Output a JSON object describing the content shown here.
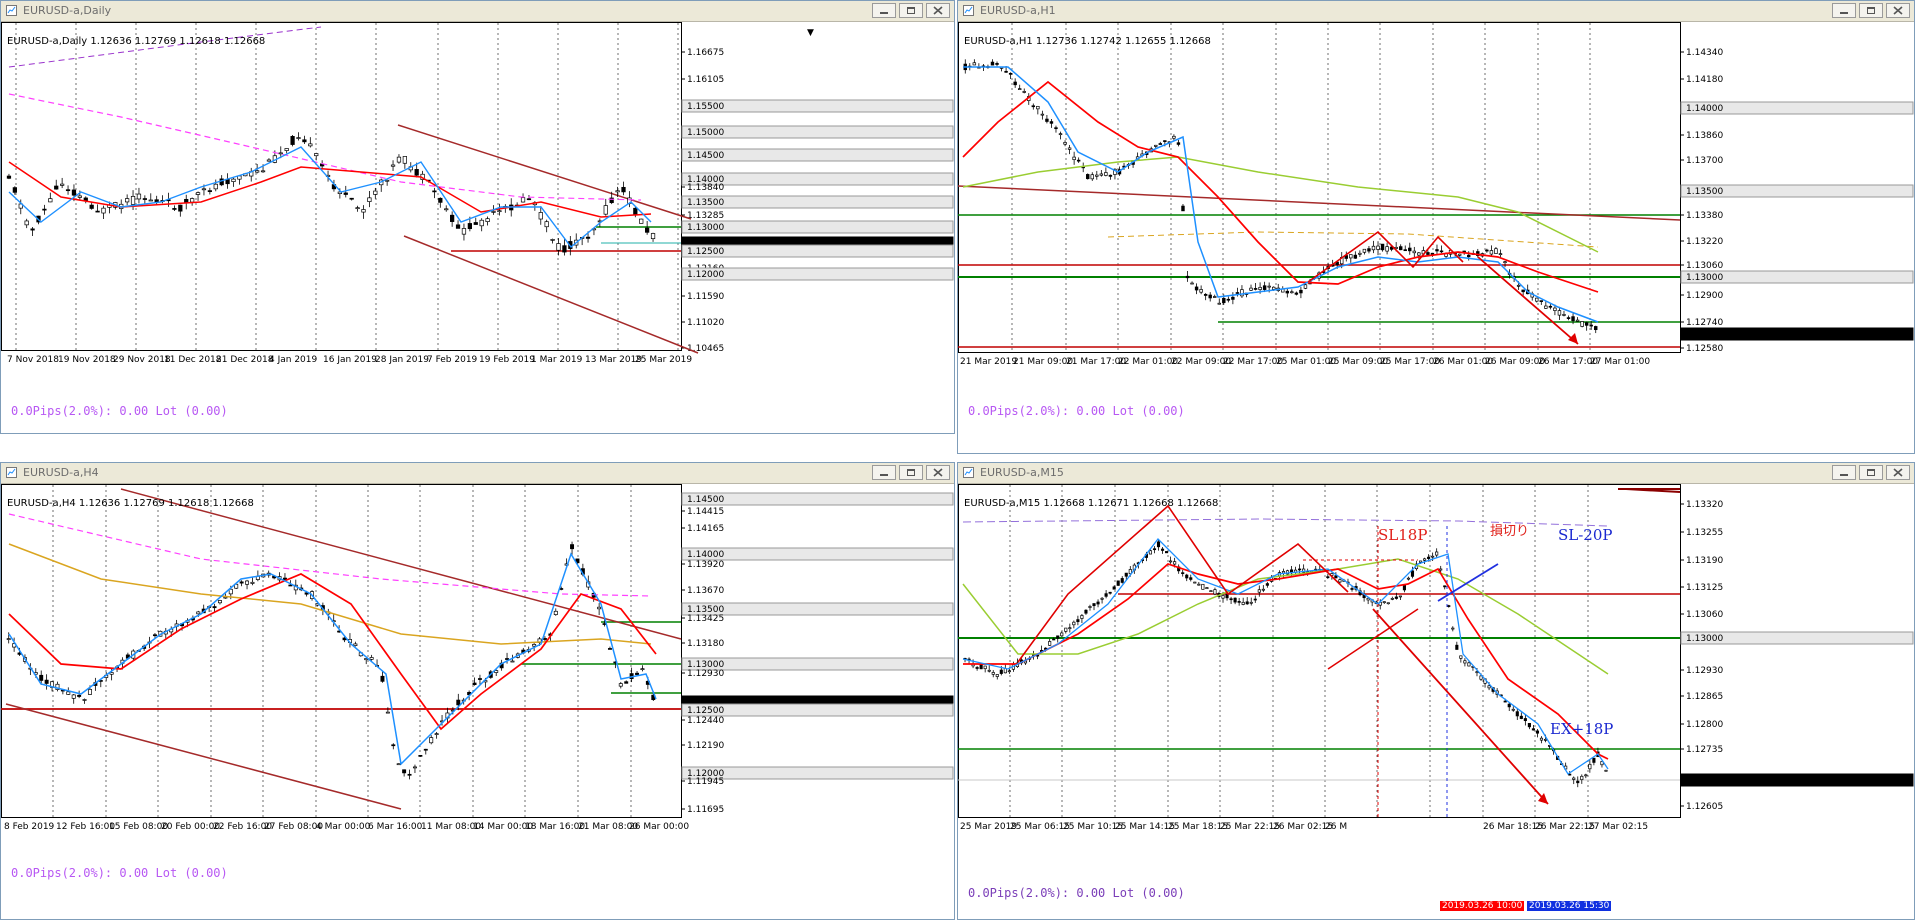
{
  "colors": {
    "up_candle": "#ffffff",
    "down_candle": "#000000",
    "ma_fast": "#1e90ff",
    "ma_mid": "#ff0000",
    "ma_slow_green": "#9acd32",
    "ma_slow_orange": "#daa520",
    "ma_long_magenta": "#ff40ff",
    "trend_line": "#a52a2a",
    "horizontal_green": "#008000",
    "horizontal_red": "#c00000",
    "current_price_tag": "#000000"
  },
  "window_buttons": [
    "minimize-button",
    "restore-button",
    "close-button"
  ],
  "charts": [
    {
      "title": "EURUSD-a,Daily",
      "header": "EURUSD-a,Daily  1.12636 1.12769 1.12618 1.12668",
      "pips": "0.0Pips(2.0%): 0.00 Lot (0.00)",
      "price_labels": [
        "1.16675",
        "1.16105",
        "1.15500",
        "1.15000",
        "1.14500",
        "1.14000",
        "1.13840",
        "1.13500",
        "1.13285",
        "1.13000",
        "1.12668",
        "1.12500",
        "1.12160",
        "1.12000",
        "1.11590",
        "1.11020",
        "1.10465"
      ],
      "time_labels": [
        "7 Nov 2018",
        "19 Nov 2018",
        "29 Nov 2018",
        "11 Dec 2018",
        "21 Dec 2018",
        "4 Jan 2019",
        "16 Jan 2019",
        "28 Jan 2019",
        "7 Feb 2019",
        "19 Feb 2019",
        "1 Mar 2019",
        "13 Mar 2019",
        "25 Mar 2019"
      ]
    },
    {
      "title": "EURUSD-a,H1",
      "header": "EURUSD-a,H1  1.12736 1.12742 1.12655 1.12668",
      "pips": "0.0Pips(2.0%): 0.00 Lot (0.00)",
      "price_labels": [
        "1.14340",
        "1.14180",
        "1.14000",
        "1.13860",
        "1.13700",
        "1.13540",
        "1.13500",
        "1.13380",
        "1.13220",
        "1.13060",
        "1.13000",
        "1.12900",
        "1.12740",
        "1.12668",
        "1.12580"
      ],
      "time_labels": [
        "21 Mar 2019",
        "21 Mar 09:00",
        "21 Mar 17:00",
        "22 Mar 01:00",
        "22 Mar 09:00",
        "22 Mar 17:00",
        "25 Mar 01:00",
        "25 Mar 09:00",
        "25 Mar 17:00",
        "26 Mar 01:00",
        "26 Mar 09:00",
        "26 Mar 17:00",
        "27 Mar 01:00"
      ]
    },
    {
      "title": "EURUSD-a,H4",
      "header": "EURUSD-a,H4  1.12636 1.12769 1.12618 1.12668",
      "pips": "0.0Pips(2.0%): 0.00 Lot (0.00)",
      "price_labels": [
        "1.14500",
        "1.14415",
        "1.14165",
        "1.14000",
        "1.13920",
        "1.13670",
        "1.13500",
        "1.13425",
        "1.13180",
        "1.13000",
        "1.12930",
        "1.12668",
        "1.12500",
        "1.12440",
        "1.12190",
        "1.12000",
        "1.11945",
        "1.11695"
      ],
      "time_labels": [
        "8 Feb 2019",
        "12 Feb 16:00",
        "15 Feb 08:00",
        "20 Feb 00:00",
        "22 Feb 16:00",
        "27 Feb 08:00",
        "4 Mar 00:00",
        "6 Mar 16:00",
        "11 Mar 08:00",
        "14 Mar 00:00",
        "18 Mar 16:00",
        "21 Mar 08:00",
        "26 Mar 00:00"
      ]
    },
    {
      "title": "EURUSD-a,M15",
      "header": "EURUSD-a,M15  1.12668 1.12671 1.12668 1.12668",
      "pips": "0.0Pips(2.0%): 0.00 Lot (0.00)",
      "price_labels": [
        "1.13320",
        "1.13255",
        "1.13190",
        "1.13125",
        "1.13060",
        "1.13000",
        "1.12930",
        "1.12865",
        "1.12800",
        "1.12735",
        "1.12668",
        "1.12605"
      ],
      "time_labels": [
        "25 Mar 2019",
        "25 Mar 06:15",
        "25 Mar 10:15",
        "25 Mar 14:15",
        "25 Mar 18:15",
        "25 Mar 22:15",
        "26 Mar 02:15",
        "26 M",
        "26 Mar 18:15",
        "26 Mar 22:15",
        "27 Mar 02:15"
      ],
      "annotations": {
        "sl18": "SL18P",
        "cut": "損切り",
        "sl20": "SL-20P",
        "ex18": "EX+18P"
      },
      "timestamps": [
        "2019.03.26 10:00",
        "2019.03.26 15:30"
      ]
    }
  ]
}
